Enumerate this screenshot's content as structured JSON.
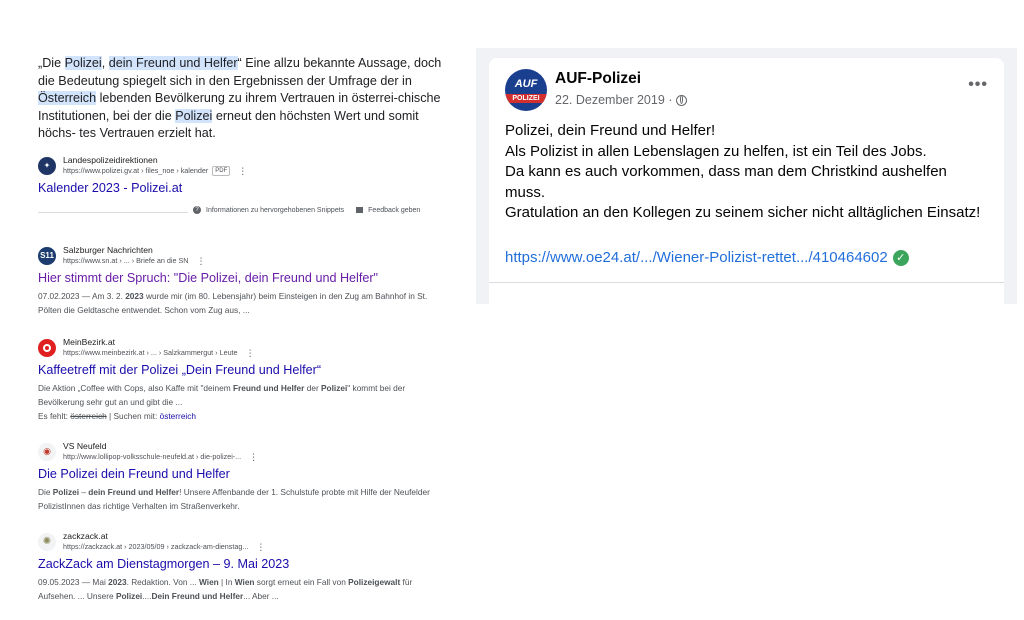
{
  "snippet": {
    "parts": [
      {
        "t": "„Die ",
        "hl": false
      },
      {
        "t": "Polizei",
        "hl": true
      },
      {
        "t": ", ",
        "hl": false
      },
      {
        "t": "dein Freund und Helfer",
        "hl": true
      },
      {
        "t": "“ Eine allzu bekannte Aussage, doch die Bedeutung spiegelt sich in den Ergebnissen der Umfrage der in ",
        "hl": false
      },
      {
        "t": "Österreich",
        "hl": true
      },
      {
        "t": " lebenden Bevölkerung zu ihrem Vertrauen in österrei-chische Institutionen, bei der die ",
        "hl": false
      },
      {
        "t": "Polizei",
        "hl": true
      },
      {
        "t": " erneut den höchsten Wert und somit höchs- tes Vertrauen erzielt hat.",
        "hl": false
      }
    ]
  },
  "featured_source": {
    "site": "Landespolizeidirektionen",
    "url": "https://www.polizei.gv.at › files_noe › kalender",
    "badge": "PDF",
    "title": "Kalender 2023 - Polizei.at"
  },
  "feedback_bar": {
    "info": "Informationen zu hervorgehobenen Snippets",
    "feedback": "Feedback geben"
  },
  "results": [
    {
      "site": "Salzburger Nachrichten",
      "url": "https://www.sn.at › ... › Briefe an die SN",
      "title": "Hier stimmt der Spruch: \"Die Polizei, dein Freund und Helfer\"",
      "desc_html": "07.02.2023 — Am 3. 2. <b>2023</b> wurde mir (im 80. Lebensjahr) beim Einsteigen in den Zug am Bahnhof in St. Pölten die Geldtasche entwendet. Schon vom Zug aus, ...",
      "favicon_text": "S11",
      "favicon_color": "#1c3b6e"
    },
    {
      "site": "MeinBezirk.at",
      "url": "https://www.meinbezirk.at › ... › Salzkammergut › Leute",
      "title": "Kaffeetreff mit der Polizei „Dein Freund und Helfer“",
      "desc_html": "Die Aktion „Coffee with Cops, also Kaffe mit \"deinem <b>Freund und Helfer</b> der <b>Polizei</b>\" kommt bei der Bevölkerung sehr gut an und gibt die ...",
      "missing_label": "Es fehlt:",
      "missing_word": "österreich",
      "search_with_label": "| Suchen mit:",
      "search_with_word": "österreich",
      "favicon_text": "",
      "favicon_color": "#e02020"
    },
    {
      "site": "VS Neufeld",
      "url": "http://www.lollipop-volksschule-neufeld.at › die-polizei-...",
      "title": "Die Polizei dein Freund und Helfer",
      "desc_html": "Die <b>Polizei</b> – <b>dein Freund und Helfer</b>! Unsere Affenbande der 1. Schulstufe probte mit Hilfe der Neufelder PolizistInnen das richtige Verhalten im Straßenverkehr.",
      "favicon_text": "",
      "favicon_color": "#f1f3f4"
    },
    {
      "site": "zackzack.at",
      "url": "https://zackzack.at › 2023/05/09 › zackzack-am-dienstag...",
      "title": "ZackZack am Dienstagmorgen – 9. Mai 2023",
      "desc_html": "09.05.2023 — Mai <b>2023</b>. Redaktion. Von ... <b>Wien</b> | In <b>Wien</b> sorgt erneut ein Fall von <b>Polizeigewalt</b> für Aufsehen. ... Unsere <b>Polizei</b>....<b>Dein Freund und Helfer</b>... Aber ...",
      "favicon_text": "",
      "favicon_color": "#f1f3f4"
    }
  ],
  "fb_post": {
    "page_name": "AUF-Polizei",
    "date": "22. Dezember 2019 ·",
    "avatar_top": "AUF",
    "avatar_bottom": "POLIZEI",
    "lines": [
      "Polizei, dein Freund und Helfer!",
      "Als Polizist in allen Lebenslagen zu helfen, ist ein Teil des Jobs.",
      "Da kann es auch vorkommen, dass man dem Christkind aushelfen muss.",
      "Gratulation an den Kollegen zu seinem sicher nicht alltäglichen Einsatz!"
    ],
    "link": "https://www.oe24.at/.../Wiener-Polizist-rettet.../410464602",
    "more": "•••",
    "colors": {
      "link": "#216fdb",
      "verified": "#3ba55c",
      "avatar": "#1a3f8f"
    }
  }
}
